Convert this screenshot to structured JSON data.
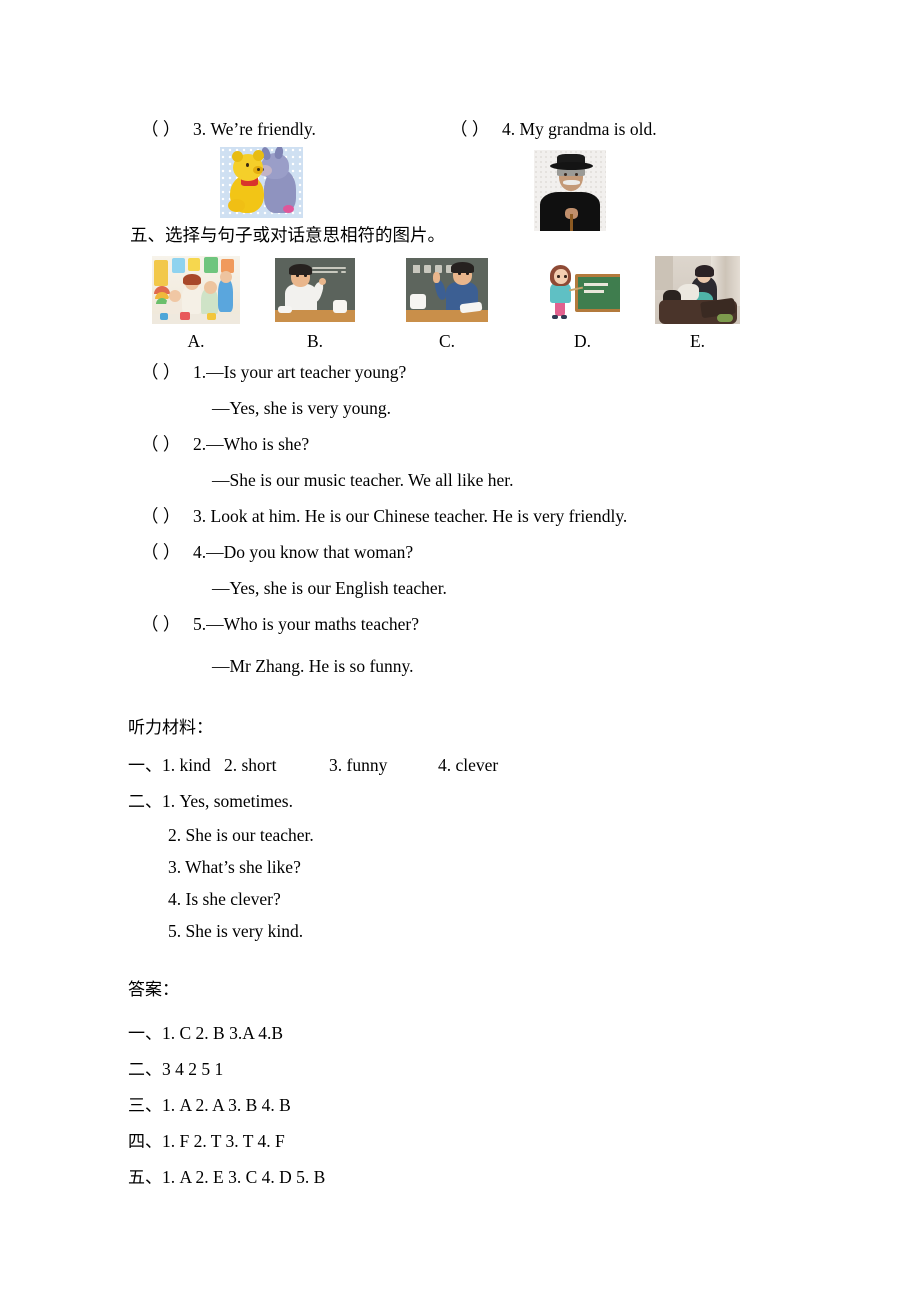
{
  "document": {
    "type": "english-exercise-worksheet",
    "language": "zh-CN + en"
  },
  "top_questions": [
    {
      "bracket": "（      ）",
      "number": "3.",
      "text": "We’re friendly.",
      "image": "pooh-and-eeyore-hugging"
    },
    {
      "bracket": "（      ）",
      "number": "4.",
      "text": "My grandma is old.",
      "image": "old-man-with-hat-and-cane"
    }
  ],
  "section_five": {
    "heading": "五、选择与句子或对话意思相符的图片。",
    "options": [
      {
        "label": "A.",
        "image": "teacher-with-young-children-in-classroom"
      },
      {
        "label": "B.",
        "image": "male-teacher-at-blackboard-with-maths-equation"
      },
      {
        "label": "C.",
        "image": "male-teacher-pointing-at-chinese-blackboard"
      },
      {
        "label": "D.",
        "image": "cartoon-girl-teacher-with-green-chalkboard"
      },
      {
        "label": "E.",
        "image": "woman-playing-instrument-in-room"
      }
    ],
    "board_texts": {
      "b_equation": "62.3 + 52.4 = ?",
      "c_chinese": "日 积 月 累",
      "d_board": "TEACHER"
    },
    "items": [
      {
        "bracket": "（      ）",
        "number": "1.",
        "line1": "—Is your art teacher young?",
        "line2": "—Yes, she is very young."
      },
      {
        "bracket": "（      ）",
        "number": "2.",
        "line1": "—Who is she?",
        "line2": "—She is our music teacher. We all like her."
      },
      {
        "bracket": "（      ）",
        "number": "3.",
        "line1": " Look at him. He is our Chinese teacher. He is very friendly.",
        "line2": ""
      },
      {
        "bracket": "（      ）",
        "number": "4.",
        "line1": "—Do you know that woman?",
        "line2": "—Yes, she is our English teacher."
      },
      {
        "bracket": "（      ）",
        "number": "5.",
        "line1": "—Who is your maths teacher?",
        "line2": "—Mr Zhang. He is so funny."
      }
    ]
  },
  "listening_material": {
    "heading": "听力材料：",
    "group_one": {
      "marker": "一、",
      "items": [
        "1. kind",
        "2. short",
        "3. funny",
        "4. clever"
      ]
    },
    "group_two": {
      "marker": "二、",
      "first": "1. Yes, sometimes.",
      "rest": [
        "2. She is our teacher.",
        "3. What’s she like?",
        "4. Is she clever?",
        "5. She is very kind."
      ]
    }
  },
  "answers": {
    "heading": "答案：",
    "rows": [
      {
        "marker": "一、",
        "values": "1. C   2. B   3.A   4.B"
      },
      {
        "marker": "二、",
        "values": "3   4   2   5   1"
      },
      {
        "marker": "三、",
        "values": "1. A   2. A   3. B   4. B"
      },
      {
        "marker": "四、",
        "values": "1. F   2. T   3. T   4. F"
      },
      {
        "marker": "五、",
        "values": "1. A   2. E   3. C   4. D   5. B"
      }
    ]
  }
}
